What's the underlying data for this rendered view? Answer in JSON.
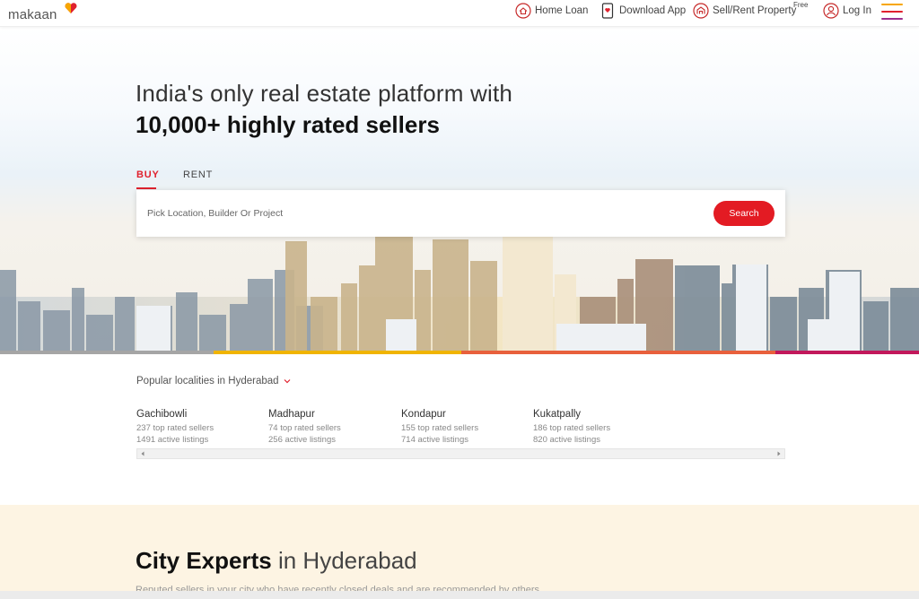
{
  "header": {
    "logo_text": "makaan",
    "nav": {
      "home_loan": "Home Loan",
      "download_app": "Download App",
      "sell_rent": "Sell/Rent Property",
      "free_tag": "Free",
      "login": "Log In"
    },
    "hamburger_colors": [
      "#f7a600",
      "#e0222e",
      "#9b2f8f"
    ]
  },
  "hero": {
    "headline_line1": "India's only real estate platform with",
    "headline_line2": "10,000+ highly rated sellers",
    "tabs": [
      {
        "label": "BUY",
        "active": true
      },
      {
        "label": "RENT",
        "active": false
      }
    ],
    "search": {
      "placeholder": "Pick Location, Builder Or Project",
      "button_label": "Search"
    },
    "strip_colors": [
      "#9e9e9e",
      "#f0b400",
      "#e8603c",
      "#c2185b"
    ]
  },
  "localities": {
    "title": "Popular localities in Hyderabad",
    "items": [
      {
        "name": "Gachibowli",
        "sellers": "237 top rated sellers",
        "listings": "1491 active listings"
      },
      {
        "name": "Madhapur",
        "sellers": "74 top rated sellers",
        "listings": "256 active listings"
      },
      {
        "name": "Kondapur",
        "sellers": "155 top rated sellers",
        "listings": "714 active listings"
      },
      {
        "name": "Kukatpally",
        "sellers": "186 top rated sellers",
        "listings": "820 active listings"
      }
    ]
  },
  "experts": {
    "title_bold": "City Experts",
    "title_rest": "in Hyderabad",
    "subtitle": "Reputed sellers in your city who have recently closed deals and are recommended by others"
  },
  "colors": {
    "accent": "#e31b23",
    "experts_bg": "#fdf4e3"
  }
}
